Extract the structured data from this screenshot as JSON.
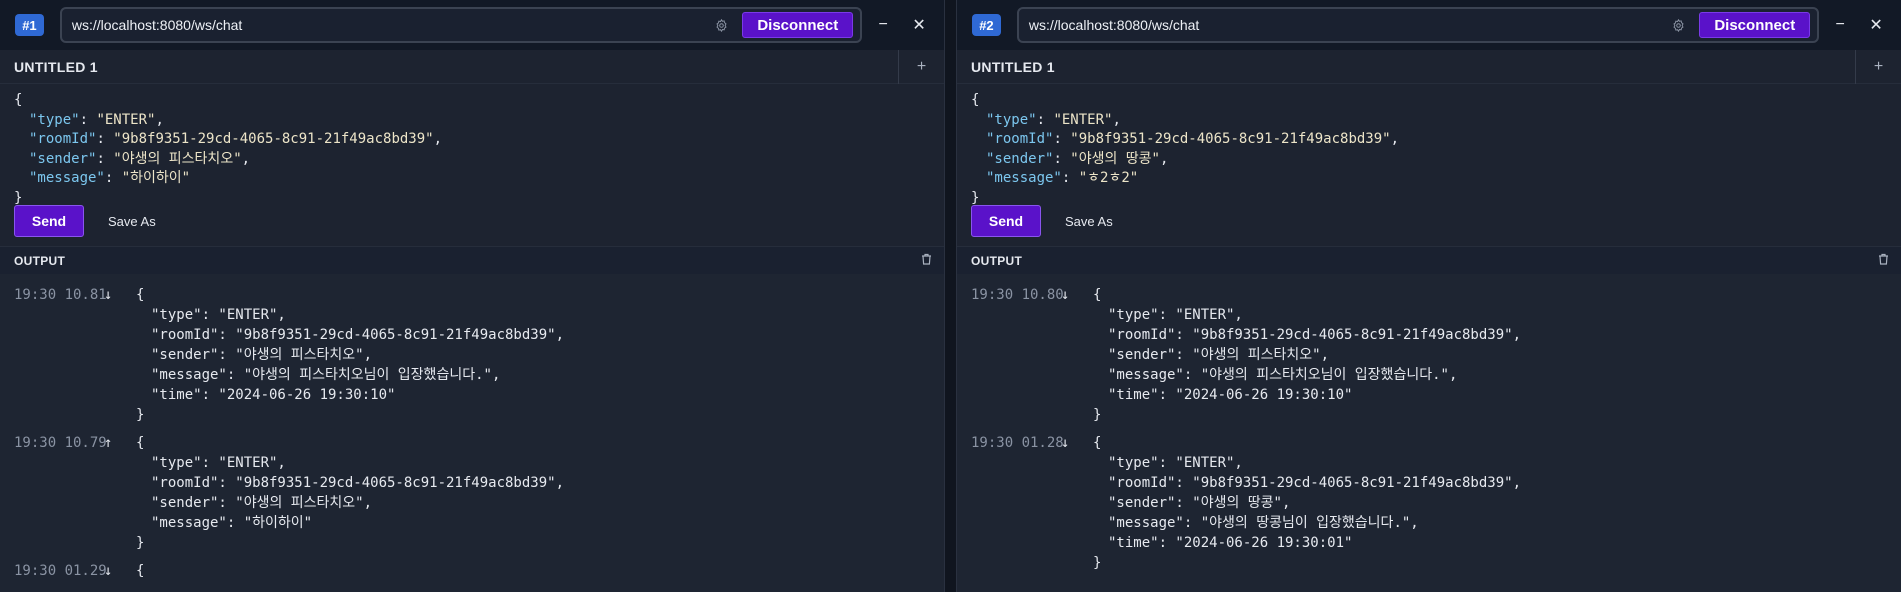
{
  "colors": {
    "accent": "#5a12c9",
    "badge": "#2f69d4",
    "key": "#7cc7ef",
    "string": "#ece4c8"
  },
  "panels": [
    {
      "badge": "#1",
      "url": "ws://localhost:8080/ws/chat",
      "disconnect_label": "Disconnect",
      "minimize_label": "−",
      "close_label": "✕",
      "tab_title": "UNTITLED 1",
      "add_label": "+",
      "editor": {
        "open": "{",
        "close": "}",
        "fields": [
          {
            "key": "\"type\"",
            "colon": ": ",
            "value": "\"ENTER\"",
            "comma": ","
          },
          {
            "key": "\"roomId\"",
            "colon": ": ",
            "value": "\"9b8f9351-29cd-4065-8c91-21f49ac8bd39\"",
            "comma": ","
          },
          {
            "key": "\"sender\"",
            "colon": ": ",
            "value": "\"야생의 피스타치오\"",
            "comma": ","
          },
          {
            "key": "\"message\"",
            "colon": ": ",
            "value": "\"하이하이\"",
            "comma": ""
          }
        ]
      },
      "send_label": "Send",
      "save_as_label": "Save As",
      "output_label": "OUTPUT",
      "output": [
        {
          "time": "19:30 10.81",
          "dir": "↓",
          "open": "{",
          "close": "}",
          "lines": [
            "\"type\": \"ENTER\",",
            "\"roomId\": \"9b8f9351-29cd-4065-8c91-21f49ac8bd39\",",
            "\"sender\": \"야생의 피스타치오\",",
            "\"message\": \"야생의 피스타치오님이 입장했습니다.\",",
            "\"time\": \"2024-06-26 19:30:10\""
          ]
        },
        {
          "time": "19:30 10.79",
          "dir": "↑",
          "open": "{",
          "close": "}",
          "lines": [
            "\"type\": \"ENTER\",",
            "\"roomId\": \"9b8f9351-29cd-4065-8c91-21f49ac8bd39\",",
            "\"sender\": \"야생의 피스타치오\",",
            "\"message\": \"하이하이\""
          ]
        },
        {
          "time": "19:30 01.29",
          "dir": "↓",
          "open": "{",
          "close": "",
          "lines": []
        }
      ]
    },
    {
      "badge": "#2",
      "url": "ws://localhost:8080/ws/chat",
      "disconnect_label": "Disconnect",
      "minimize_label": "−",
      "close_label": "✕",
      "tab_title": "UNTITLED 1",
      "add_label": "+",
      "editor": {
        "open": "{",
        "close": "}",
        "fields": [
          {
            "key": "\"type\"",
            "colon": ": ",
            "value": "\"ENTER\"",
            "comma": ","
          },
          {
            "key": "\"roomId\"",
            "colon": ": ",
            "value": "\"9b8f9351-29cd-4065-8c91-21f49ac8bd39\"",
            "comma": ","
          },
          {
            "key": "\"sender\"",
            "colon": ": ",
            "value": "\"야생의 땅콩\"",
            "comma": ","
          },
          {
            "key": "\"message\"",
            "colon": ": ",
            "value": "\"ㅎ2ㅎ2\"",
            "comma": ""
          }
        ]
      },
      "send_label": "Send",
      "save_as_label": "Save As",
      "output_label": "OUTPUT",
      "output": [
        {
          "time": "19:30 10.80",
          "dir": "↓",
          "open": "{",
          "close": "}",
          "lines": [
            "\"type\": \"ENTER\",",
            "\"roomId\": \"9b8f9351-29cd-4065-8c91-21f49ac8bd39\",",
            "\"sender\": \"야생의 피스타치오\",",
            "\"message\": \"야생의 피스타치오님이 입장했습니다.\",",
            "\"time\": \"2024-06-26 19:30:10\""
          ]
        },
        {
          "time": "19:30 01.28",
          "dir": "↓",
          "open": "{",
          "close": "}",
          "lines": [
            "\"type\": \"ENTER\",",
            "\"roomId\": \"9b8f9351-29cd-4065-8c91-21f49ac8bd39\",",
            "\"sender\": \"야생의 땅콩\",",
            "\"message\": \"야생의 땅콩님이 입장했습니다.\",",
            "\"time\": \"2024-06-26 19:30:01\""
          ]
        }
      ]
    }
  ]
}
